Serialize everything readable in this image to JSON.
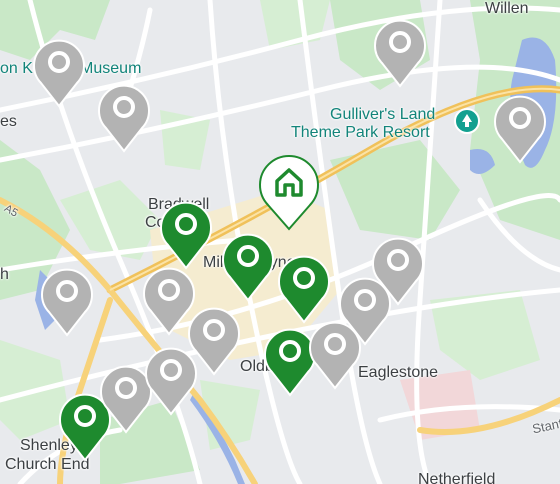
{
  "map": {
    "labels": {
      "willen": "Willen",
      "museum": "on Keynes Museum",
      "es": "es",
      "gullivers_line1": "Gulliver's Land",
      "gullivers_line2": "Theme Park Resort",
      "bradwell_line1": "Bradwell",
      "bradwell_line2": "Common",
      "milton_keynes": "Milton Keynes",
      "h": "h",
      "oldbrook": "Oldbrook",
      "eaglestone": "Eaglestone",
      "shenley_line1": "Shenley",
      "shenley_line2": "Church End",
      "netherfield": "Netherfield",
      "a5": "A5",
      "stanton": "Stanton"
    },
    "markers": {
      "home": {
        "type": "home",
        "icon": "home-icon",
        "color": "#1e8a2e"
      },
      "property_pins": [
        {
          "status": "highlighted",
          "color": "#1e8a2e"
        },
        {
          "status": "highlighted",
          "color": "#1e8a2e"
        },
        {
          "status": "highlighted",
          "color": "#1e8a2e"
        },
        {
          "status": "highlighted",
          "color": "#1e8a2e"
        },
        {
          "status": "highlighted",
          "color": "#1e8a2e"
        },
        {
          "status": "default",
          "color": "#b3b3b3"
        },
        {
          "status": "default",
          "color": "#b3b3b3"
        },
        {
          "status": "default",
          "color": "#b3b3b3"
        },
        {
          "status": "default",
          "color": "#b3b3b3"
        },
        {
          "status": "default",
          "color": "#b3b3b3"
        },
        {
          "status": "default",
          "color": "#b3b3b3"
        },
        {
          "status": "default",
          "color": "#b3b3b3"
        },
        {
          "status": "default",
          "color": "#b3b3b3"
        },
        {
          "status": "default",
          "color": "#b3b3b3"
        },
        {
          "status": "default",
          "color": "#b3b3b3"
        },
        {
          "status": "default",
          "color": "#b3b3b3"
        },
        {
          "status": "default",
          "color": "#b3b3b3"
        }
      ]
    },
    "colors": {
      "land": "#e8eaed",
      "park": "#c9e8c7",
      "water": "#9ab3e6",
      "major_road": "#f7d27a",
      "road": "#ffffff",
      "urban": "#f5ecd0"
    }
  }
}
